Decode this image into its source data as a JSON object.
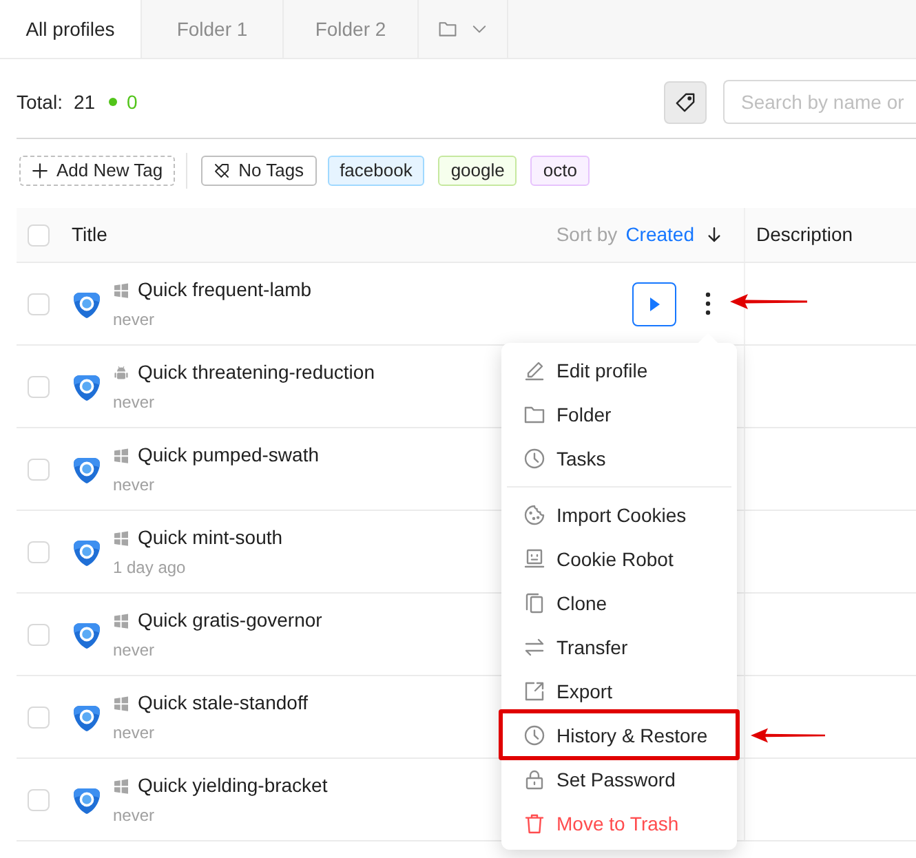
{
  "tabs": [
    {
      "kind": "text",
      "label": "All profiles",
      "selected": true
    },
    {
      "kind": "text",
      "label": "Folder 1",
      "selected": false
    },
    {
      "kind": "text",
      "label": "Folder 2",
      "selected": false
    },
    {
      "kind": "folder-dropdown",
      "selected": false
    }
  ],
  "toolbar": {
    "total_label": "Total:",
    "total_count": "21",
    "online_count": "0",
    "search": {
      "placeholder": "Search by name or"
    }
  },
  "tags": {
    "add_label": "Add New Tag",
    "items": [
      {
        "kind": "none",
        "label": "No Tags"
      },
      {
        "kind": "tag",
        "label": "facebook",
        "color": "#e6f4ff"
      },
      {
        "kind": "tag",
        "label": "google",
        "color": "#f6ffed"
      },
      {
        "kind": "tag",
        "label": "octo",
        "color": "#f9f0ff"
      }
    ]
  },
  "table": {
    "columns": [
      "Title",
      "Description"
    ],
    "all_checked": false,
    "sort": {
      "label": "Sort by",
      "field": "Created",
      "descending": true
    },
    "rows": [
      {
        "kind": "windows",
        "title": "Quick frequent-lamb",
        "subtitle": "never",
        "checked": false,
        "hovered": true,
        "arrow": true
      },
      {
        "kind": "android",
        "title": "Quick threatening-reduction",
        "subtitle": "never",
        "checked": false,
        "hovered": false,
        "arrow": false
      },
      {
        "kind": "windows",
        "title": "Quick pumped-swath",
        "subtitle": "never",
        "checked": false,
        "hovered": false,
        "arrow": false
      },
      {
        "kind": "windows",
        "title": "Quick mint-south",
        "subtitle": "1 day ago",
        "checked": false,
        "hovered": false,
        "arrow": false
      },
      {
        "kind": "windows",
        "title": "Quick gratis-governor",
        "subtitle": "never",
        "checked": false,
        "hovered": false,
        "arrow": false
      },
      {
        "kind": "windows",
        "title": "Quick stale-standoff",
        "subtitle": "never",
        "checked": false,
        "hovered": false,
        "arrow": false
      },
      {
        "kind": "windows",
        "title": "Quick yielding-bracket",
        "subtitle": "never",
        "checked": false,
        "hovered": false,
        "arrow": false
      }
    ]
  },
  "menu": {
    "groups": [
      {
        "items": [
          {
            "kind": "normal",
            "label": "Edit profile",
            "outlined": false
          },
          {
            "kind": "normal",
            "label": "Folder",
            "outlined": false
          },
          {
            "kind": "normal",
            "label": "Tasks",
            "outlined": false
          }
        ]
      },
      {
        "items": [
          {
            "kind": "normal",
            "label": "Import Cookies",
            "outlined": false
          },
          {
            "kind": "normal",
            "label": "Cookie Robot",
            "outlined": false
          },
          {
            "kind": "normal",
            "label": "Clone",
            "outlined": false
          },
          {
            "kind": "normal",
            "label": "Transfer",
            "outlined": false
          },
          {
            "kind": "normal",
            "label": "Export",
            "outlined": false
          },
          {
            "kind": "normal",
            "label": "History & Restore",
            "outlined": true
          },
          {
            "kind": "normal",
            "label": "Set Password",
            "outlined": false
          },
          {
            "kind": "danger",
            "label": "Move to Trash",
            "outlined": false
          }
        ]
      }
    ]
  }
}
